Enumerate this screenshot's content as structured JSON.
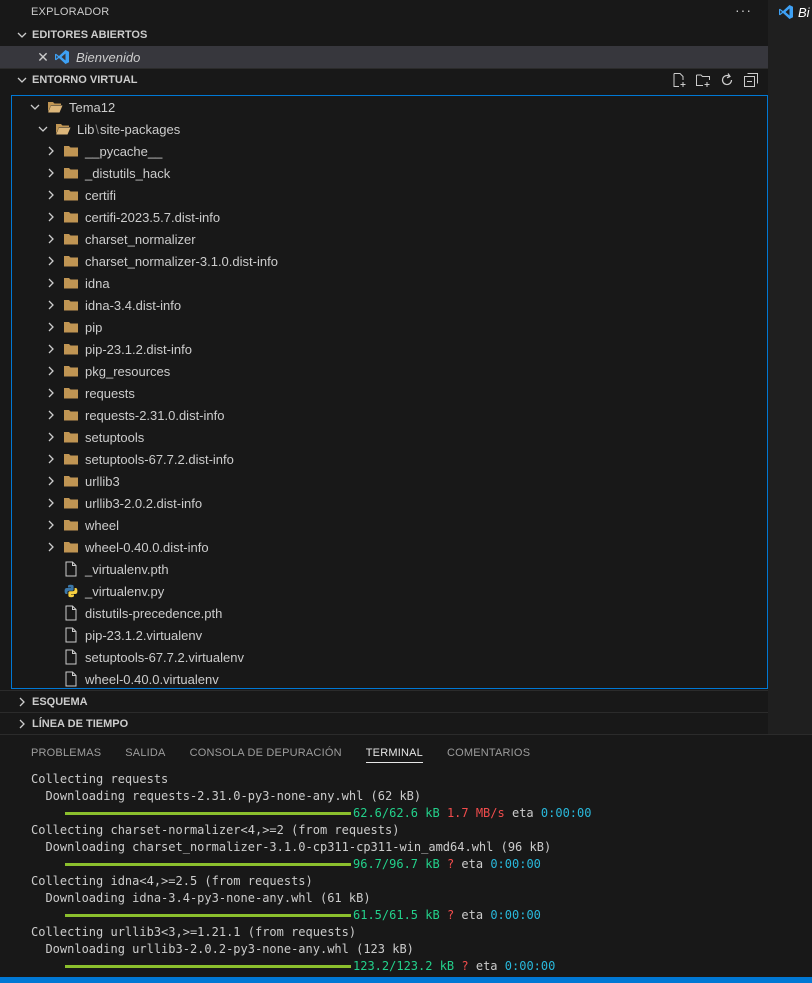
{
  "sidebar": {
    "title": "EXPLORADOR",
    "more_label": "···"
  },
  "open_editors": {
    "header": "EDITORES ABIERTOS",
    "items": [
      {
        "label": "Bienvenido"
      }
    ]
  },
  "env": {
    "header": "ENTORNO VIRTUAL",
    "root": "Tema12",
    "subfolder_a": "Lib",
    "subfolder_sep": "\\",
    "subfolder_b": "site-packages",
    "folders": [
      "__pycache__",
      "_distutils_hack",
      "certifi",
      "certifi-2023.5.7.dist-info",
      "charset_normalizer",
      "charset_normalizer-3.1.0.dist-info",
      "idna",
      "idna-3.4.dist-info",
      "pip",
      "pip-23.1.2.dist-info",
      "pkg_resources",
      "requests",
      "requests-2.31.0.dist-info",
      "setuptools",
      "setuptools-67.7.2.dist-info",
      "urllib3",
      "urllib3-2.0.2.dist-info",
      "wheel",
      "wheel-0.40.0.dist-info"
    ],
    "files": [
      {
        "name": "_virtualenv.pth",
        "icon": "file-icon"
      },
      {
        "name": "_virtualenv.py",
        "icon": "python-icon"
      },
      {
        "name": "distutils-precedence.pth",
        "icon": "file-icon"
      },
      {
        "name": "pip-23.1.2.virtualenv",
        "icon": "file-icon"
      },
      {
        "name": "setuptools-67.7.2.virtualenv",
        "icon": "file-icon"
      },
      {
        "name": "wheel-0.40.0.virtualenv",
        "icon": "file-icon"
      }
    ]
  },
  "outline": {
    "header": "ESQUEMA"
  },
  "timeline": {
    "header": "LÍNEA DE TIEMPO"
  },
  "editor_tab": {
    "label": "Bi"
  },
  "panel": {
    "tabs": [
      "PROBLEMAS",
      "SALIDA",
      "CONSOLA DE DEPURACIÓN",
      "TERMINAL",
      "COMENTARIOS"
    ],
    "active_tab": "TERMINAL"
  },
  "terminal": {
    "blocks": [
      {
        "collect": "Collecting requests",
        "download": "  Downloading requests-2.31.0-py3-none-any.whl (62 kB)",
        "size": "62.6/62.6 kB",
        "speed": "1.7 MB/s",
        "eta_label": "eta",
        "eta": "0:00:00"
      },
      {
        "collect": "Collecting charset-normalizer<4,>=2 (from requests)",
        "download": "  Downloading charset_normalizer-3.1.0-cp311-cp311-win_amd64.whl (96 kB)",
        "size": "96.7/96.7 kB",
        "speed": "?",
        "eta_label": "eta",
        "eta": "0:00:00"
      },
      {
        "collect": "Collecting idna<4,>=2.5 (from requests)",
        "download": "  Downloading idna-3.4-py3-none-any.whl (61 kB)",
        "size": "61.5/61.5 kB",
        "speed": "?",
        "eta_label": "eta",
        "eta": "0:00:00"
      },
      {
        "collect": "Collecting urllib3<3,>=1.21.1 (from requests)",
        "download": "  Downloading urllib3-2.0.2-py3-none-any.whl (123 kB)",
        "size": "123.2/123.2 kB",
        "speed": "?",
        "eta_label": "eta",
        "eta": "0:00:00"
      }
    ]
  },
  "colors": {
    "accent": "#0078d4",
    "folder": "#c09553",
    "progress": "#8bbf2d",
    "green": "#23d18b",
    "red": "#f14c4c",
    "cyan": "#29b8db"
  }
}
